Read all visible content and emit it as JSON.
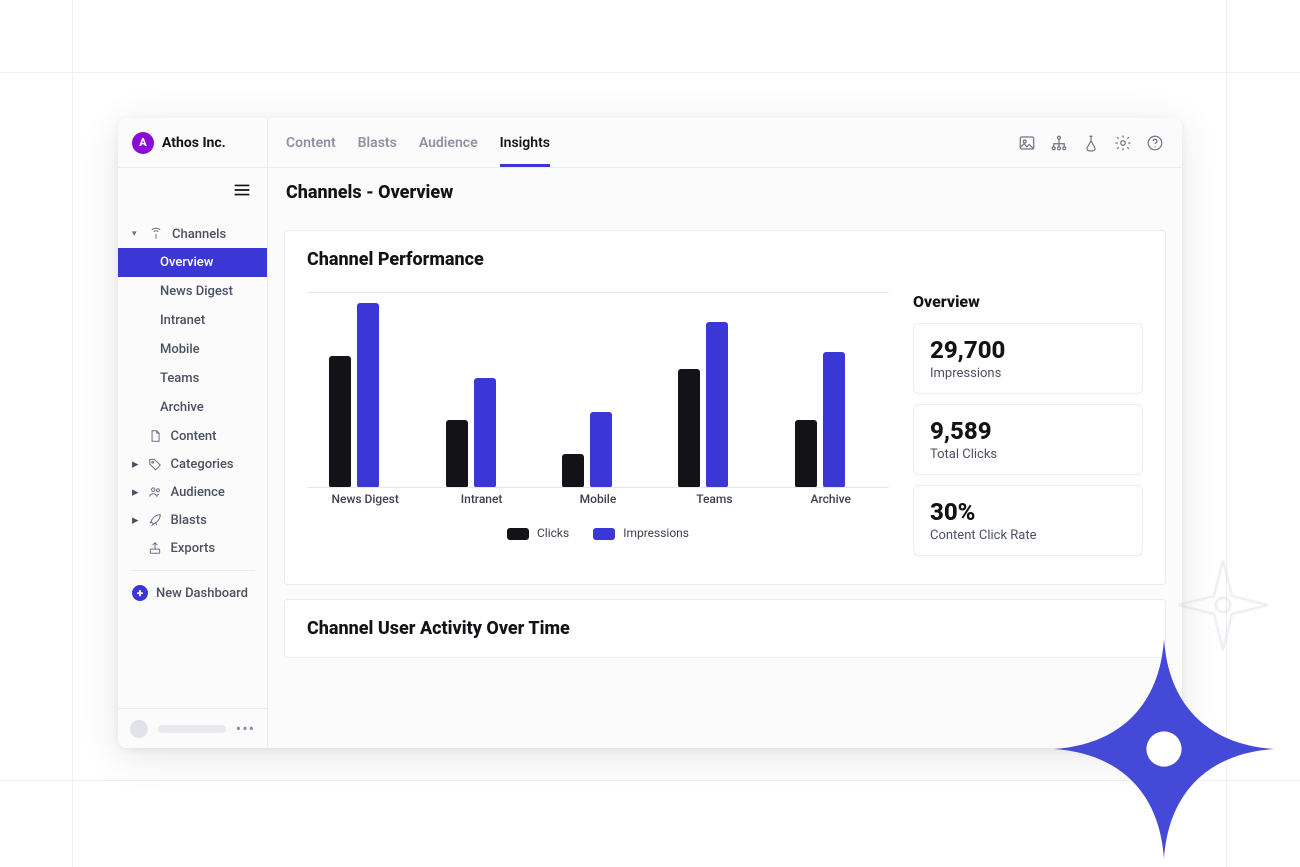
{
  "brand": {
    "name": "Athos Inc."
  },
  "topnav": {
    "items": [
      {
        "label": "Content"
      },
      {
        "label": "Blasts"
      },
      {
        "label": "Audience"
      },
      {
        "label": "Insights"
      }
    ],
    "active_index": 3
  },
  "page_title": "Channels - Overview",
  "sidebar": {
    "channels_label": "Channels",
    "children": [
      {
        "label": "Overview",
        "active": true
      },
      {
        "label": "News Digest"
      },
      {
        "label": "Intranet"
      },
      {
        "label": "Mobile"
      },
      {
        "label": "Teams"
      },
      {
        "label": "Archive"
      }
    ],
    "sections": [
      {
        "label": "Content",
        "icon": "file"
      },
      {
        "label": "Categories",
        "icon": "tag",
        "expandable": true
      },
      {
        "label": "Audience",
        "icon": "people",
        "expandable": true
      },
      {
        "label": "Blasts",
        "icon": "rocket",
        "expandable": true
      },
      {
        "label": "Exports",
        "icon": "export"
      }
    ],
    "new_dashboard": "New Dashboard"
  },
  "card_performance": {
    "title": "Channel Performance",
    "legend": {
      "clicks": "Clicks",
      "impressions": "Impressions"
    },
    "overview_label": "Overview",
    "stats": [
      {
        "value": "29,700",
        "label": "Impressions"
      },
      {
        "value": "9,589",
        "label": "Total Clicks"
      },
      {
        "value": "30%",
        "label": "Content Click Rate"
      }
    ]
  },
  "card_activity": {
    "title": "Channel User Activity Over Time"
  },
  "chart_data": {
    "type": "bar",
    "categories": [
      "News Digest",
      "Intranet",
      "Mobile",
      "Teams",
      "Archive"
    ],
    "series": [
      {
        "name": "Clicks",
        "color": "#121217",
        "values": [
          70,
          36,
          18,
          63,
          36
        ]
      },
      {
        "name": "Impressions",
        "color": "#3b37d7",
        "values": [
          98,
          58,
          40,
          88,
          72
        ]
      }
    ],
    "ylim": [
      0,
      100
    ],
    "note": "Values are visual estimates (% of max bar height); no numeric axis shown in source."
  }
}
